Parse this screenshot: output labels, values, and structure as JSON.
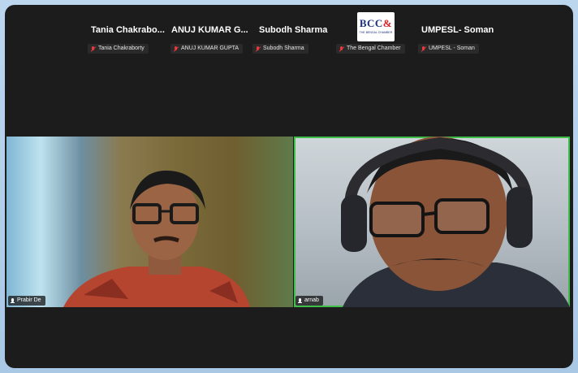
{
  "participants_strip": [
    {
      "display_name": "Tania  Chakrabo...",
      "label": "Tania Chakraborty"
    },
    {
      "display_name": "ANUJ KUMAR G...",
      "label": "ANUJ KUMAR GUPTA"
    },
    {
      "display_name": "Subodh Sharma",
      "label": "Subodh Sharma"
    },
    {
      "display_name": "",
      "label": "The Bengal Chamber",
      "logo_text": "BCC",
      "logo_amp": "&",
      "logo_subtext": "THE BENGAL CHAMBER"
    },
    {
      "display_name": "UMPESL- Soman",
      "label": "UMPESL - Soman"
    }
  ],
  "video_tiles": [
    {
      "name": "Prabir De",
      "active_speaker": false
    },
    {
      "name": "arnab",
      "active_speaker": true
    }
  ],
  "colors": {
    "background": "#1c1c1c",
    "muted_mic": "#e8383d",
    "active_speaker_border": "#3fbf4a"
  },
  "icons": {
    "strip_mic": "mic-muted-icon",
    "tile_mic": "mic-icon"
  }
}
